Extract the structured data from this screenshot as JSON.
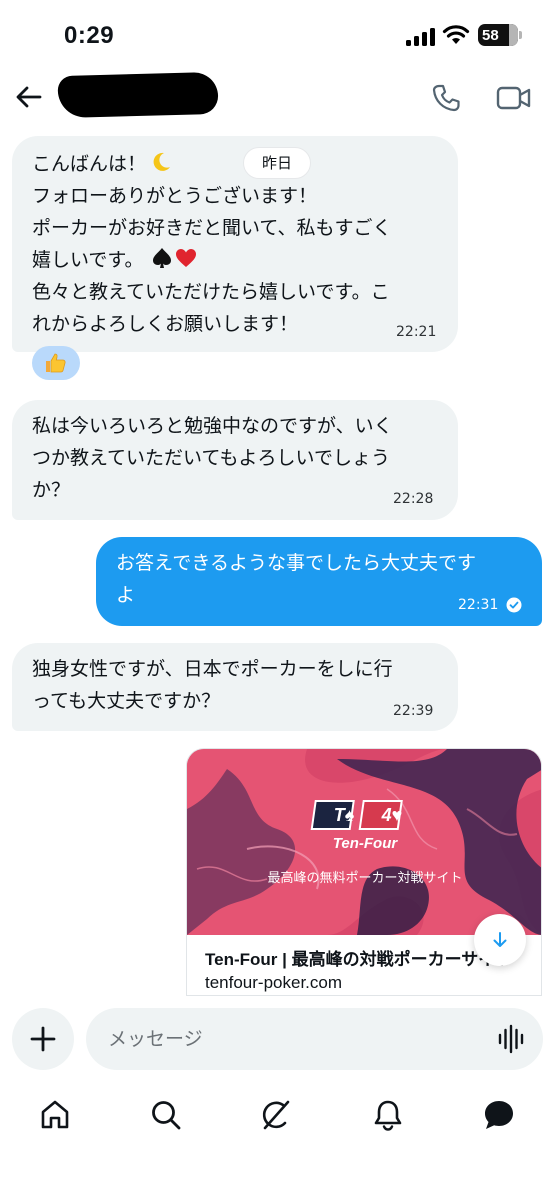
{
  "status_bar": {
    "time": "0:29",
    "battery": "58"
  },
  "header": {
    "contact_name_redacted": true
  },
  "date_separator": "昨日",
  "messages": [
    {
      "direction": "in",
      "lines": [
        "こんばんは！",
        "フォローありがとうございます！",
        "ポーカーがお好きだと聞いて、私もすごく",
        "嬉しいです。",
        "色々と教えていただけたら嬉しいです。こ",
        "れからよろしくお願いします！"
      ],
      "time": "22:21",
      "reaction": "thumbs-up"
    },
    {
      "direction": "in",
      "lines": [
        "私は今いろいろと勉強中なのですが、いく",
        "つか教えていただいてもよろしいでしょう",
        "か？"
      ],
      "time": "22:28"
    },
    {
      "direction": "out",
      "lines": [
        "お答えできるような事でしたら大丈夫です",
        "よ"
      ],
      "time": "22:31",
      "read": true
    },
    {
      "direction": "in",
      "lines": [
        "独身女性ですが、日本でポーカーをしに行",
        "っても大丈夫ですか？"
      ],
      "time": "22:39"
    }
  ],
  "link_preview": {
    "logo_left": "T♠",
    "logo_right": "4♥",
    "brand": "Ten-Four",
    "tagline": "最高峰の無料ポーカー対戦サイト",
    "title": "Ten-Four | 最高峰の対戦ポーカーサイト",
    "domain": "tenfour-poker.com"
  },
  "composer": {
    "placeholder": "メッセージ"
  },
  "colors": {
    "accent": "#1d9bf0",
    "incoming_bubble": "#eff3f4",
    "reaction_bg": "#b9d9fb"
  },
  "icons": [
    "back-arrow-icon",
    "phone-icon",
    "video-icon",
    "moon-icon",
    "spade-icon",
    "heart-icon",
    "thumbs-up-icon",
    "check-circle-icon",
    "arrow-down-icon",
    "plus-icon",
    "voice-icon",
    "home-icon",
    "search-icon",
    "grok-icon",
    "bell-icon",
    "messages-icon"
  ]
}
